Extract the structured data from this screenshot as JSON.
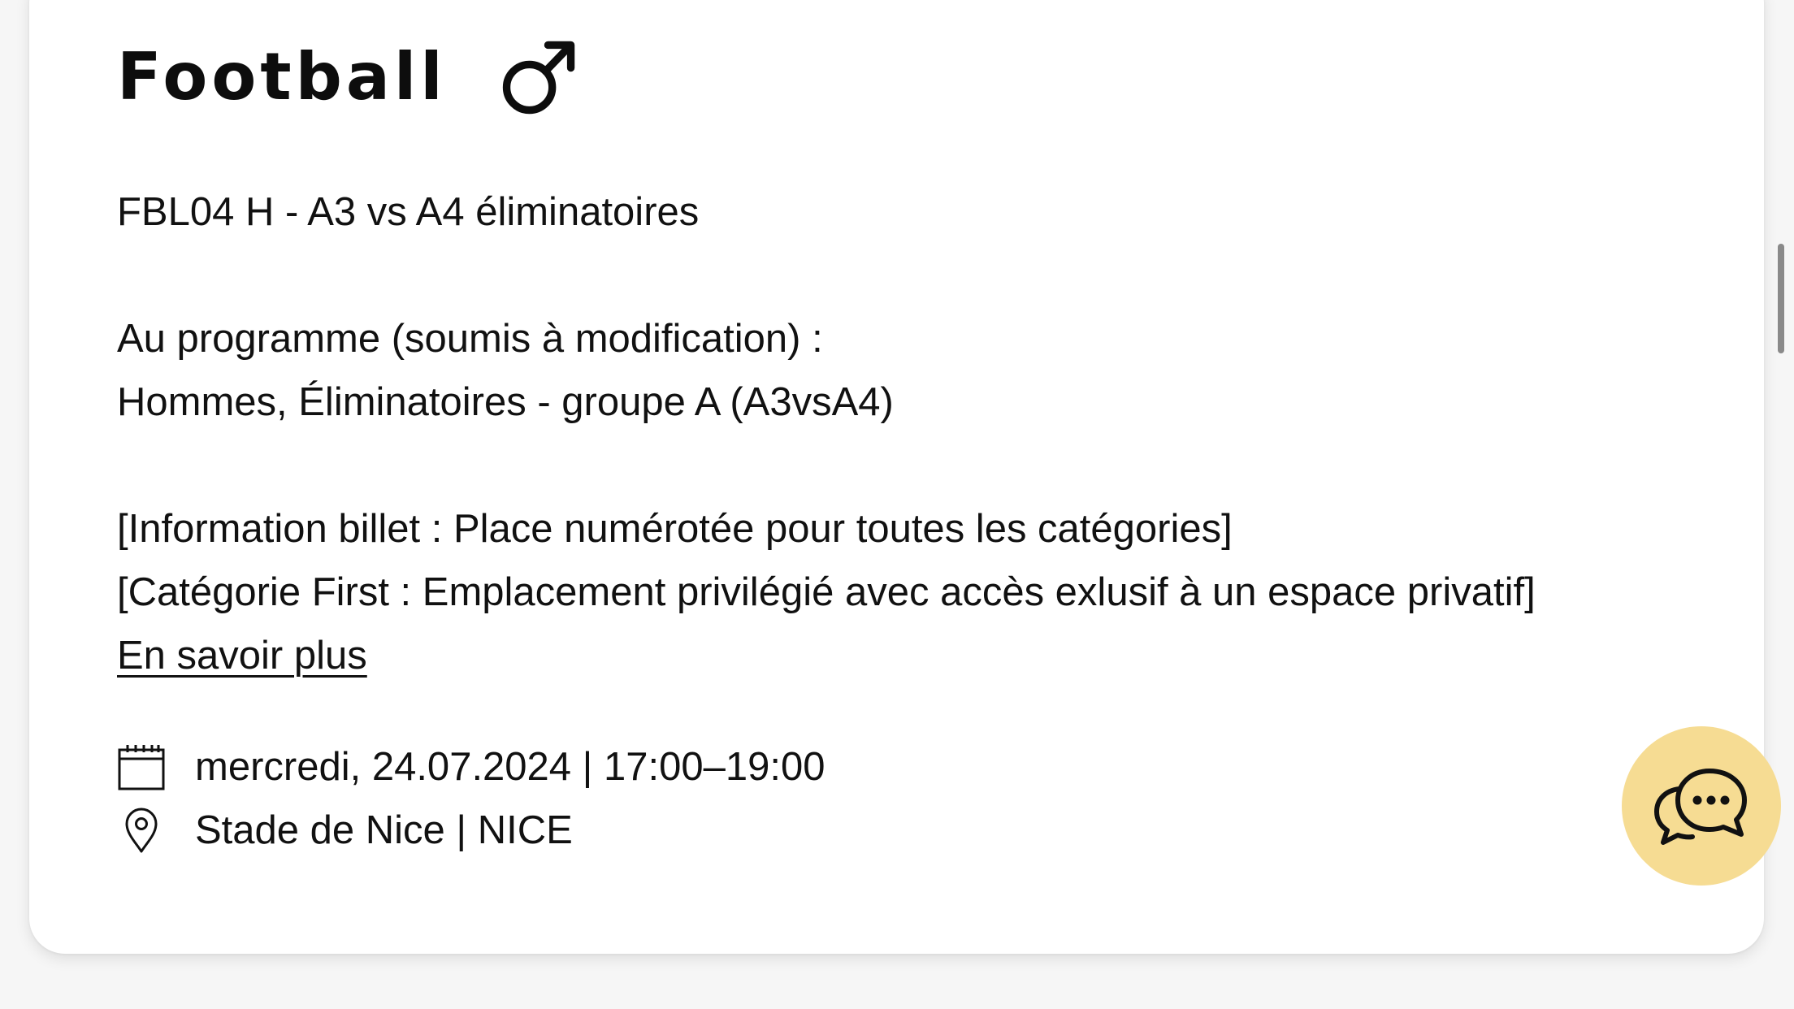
{
  "event": {
    "sport_title": "Football",
    "gender_icon": "male-symbol-icon",
    "code_line": "FBL04 H - A3 vs A4 éliminatoires",
    "programme_heading": "Au programme (soumis à modification) :",
    "programme_detail": "Hommes, Éliminatoires - groupe A (A3vsA4)",
    "ticket_info": "[Information billet : Place numérotée pour toutes les catégories]",
    "category_info": "[Catégorie First : Emplacement privilégié avec accès exlusif à un espace privatif]",
    "more_link_label": "En savoir plus",
    "date_time": "mercredi, 24.07.2024 | 17:00–19:00",
    "venue": "Stade de Nice | NICE"
  },
  "icons": {
    "date": "calendar-icon",
    "venue": "location-pin-icon",
    "chat": "chat-bubbles-icon"
  },
  "colors": {
    "chat_button_bg": "#f6dc93",
    "text": "#111111",
    "card_bg": "#ffffff",
    "page_bg": "#f6f6f6"
  }
}
